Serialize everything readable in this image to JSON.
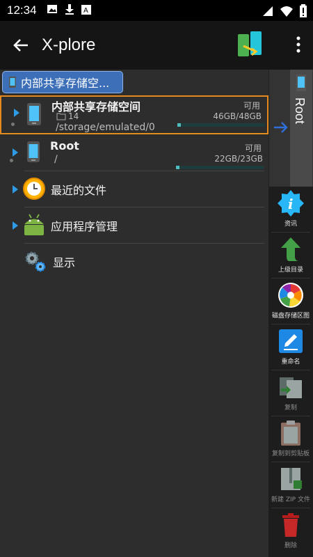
{
  "status_bar": {
    "time": "12:34"
  },
  "app_bar": {
    "title": "X-plore"
  },
  "breadcrumb": {
    "label": "内部共享存储空..."
  },
  "storage_rows": [
    {
      "name": "内部共享存储空间",
      "count": "14",
      "path": "/storage/emulated/0",
      "avail_label": "可用",
      "size": "46GB/48GB",
      "used_fraction": 0.04
    },
    {
      "name": "Root",
      "path": "/",
      "avail_label": "可用",
      "size": "22GB/23GB",
      "used_fraction": 0.04
    }
  ],
  "tree_items": [
    {
      "label": "最近的文件"
    },
    {
      "label": "应用程序管理"
    },
    {
      "label": "显示"
    }
  ],
  "right_pane": {
    "root_label": "Root"
  },
  "tools": [
    {
      "label": "资讯",
      "icon": "info-icon"
    },
    {
      "label": "上级目录",
      "icon": "up-arrow-icon"
    },
    {
      "label": "磁盘存储区图",
      "icon": "disk-map-icon"
    },
    {
      "label": "重命名",
      "icon": "rename-icon"
    },
    {
      "label": "复制",
      "icon": "copy-icon"
    },
    {
      "label": "复制到剪贴板",
      "icon": "clipboard-icon"
    },
    {
      "label": "新建 ZIP 文件",
      "icon": "zip-icon"
    },
    {
      "label": "删除",
      "icon": "trash-icon"
    }
  ],
  "colors": {
    "accent": "#e58a1f",
    "selection": "#3d6fb8",
    "bar_fill": "#4fbcc0"
  }
}
